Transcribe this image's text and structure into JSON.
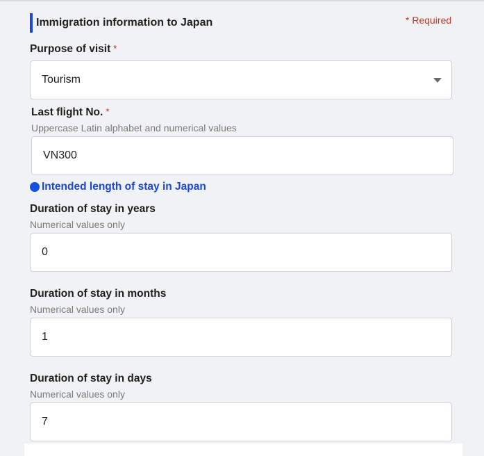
{
  "section": {
    "title": "Immigration information to Japan",
    "required_note": "* Required"
  },
  "purpose": {
    "label": "Purpose of visit",
    "required_mark": "*",
    "selected": "Tourism"
  },
  "flight": {
    "label": "Last flight No.",
    "required_mark": "*",
    "hint": "Uppercase Latin alphabet and numerical values",
    "value": "VN300"
  },
  "stay": {
    "heading": "Intended length of stay in Japan",
    "years": {
      "label": "Duration of stay in years",
      "hint": "Numerical values only",
      "value": "0"
    },
    "months": {
      "label": "Duration of stay in months",
      "hint": "Numerical values only",
      "value": "1"
    },
    "days": {
      "label": "Duration of stay in days",
      "hint": "Numerical values only",
      "value": "7"
    }
  },
  "colors": {
    "accent": "#1a47d6",
    "required": "#c62828",
    "background": "#f1f2f4"
  },
  "icons": {
    "select_arrow": "chevron-down-icon",
    "heading_bullet": "blue-dot-icon"
  }
}
